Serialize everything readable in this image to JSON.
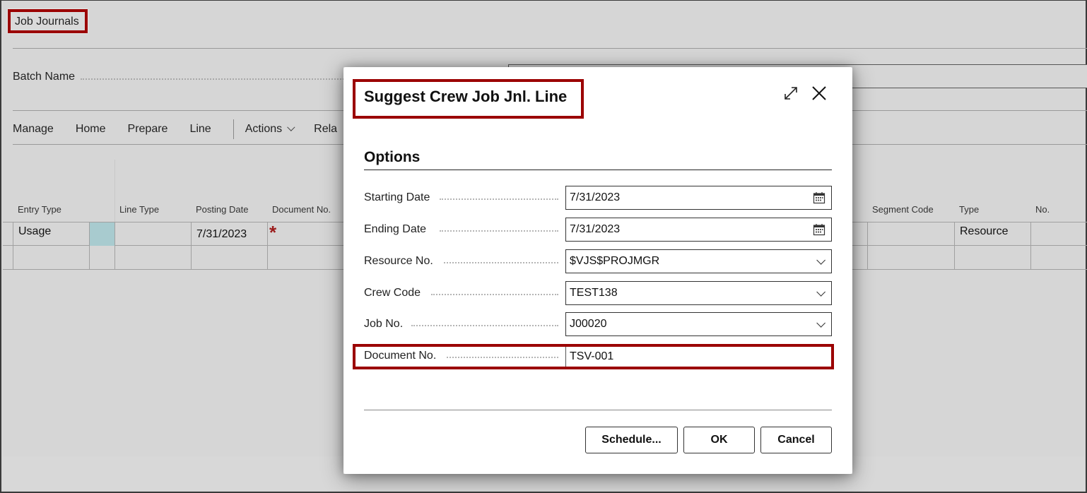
{
  "page": {
    "title": "Job Journals",
    "batch_name_label": "Batch Name",
    "batch_name_value": ""
  },
  "action_bar": {
    "items": [
      "Manage",
      "Home",
      "Prepare",
      "Line"
    ],
    "actions_label": "Actions",
    "related_label_partial": "Rela"
  },
  "grid": {
    "columns_left": [
      "Entry Type",
      "Line Type",
      "Posting Date",
      "Document No."
    ],
    "columns_right": [
      "Segment Code",
      "Type",
      "No."
    ],
    "rows": [
      {
        "entry_type": "Usage",
        "line_type": "",
        "posting_date": "7/31/2023",
        "document_no": "",
        "document_no_required": true,
        "segment_code": "",
        "type": "Resource",
        "no": ""
      },
      {
        "entry_type": "",
        "line_type": "",
        "posting_date": "",
        "document_no": "",
        "segment_code": "",
        "type": "",
        "no": ""
      }
    ],
    "required_marker": "*"
  },
  "dialog": {
    "title": "Suggest Crew Job Jnl. Line",
    "section_title": "Options",
    "fields": [
      {
        "label": "Starting Date",
        "value": "7/31/2023",
        "control": "date",
        "icon": "calendar-icon"
      },
      {
        "label": "Ending Date",
        "value": "7/31/2023",
        "control": "date",
        "icon": "calendar-icon"
      },
      {
        "label": "Resource No.",
        "value": "$VJS$PROJMGR",
        "control": "dropdown",
        "icon": "chevron-down-icon"
      },
      {
        "label": "Crew Code",
        "value": "TEST138",
        "control": "dropdown",
        "icon": "chevron-down-icon"
      },
      {
        "label": "Job No.",
        "value": "J00020",
        "control": "dropdown",
        "icon": "chevron-down-icon"
      },
      {
        "label": "Document No.",
        "value": "TSV-001",
        "control": "text",
        "icon": ""
      }
    ],
    "buttons": {
      "schedule": "Schedule...",
      "ok": "OK",
      "cancel": "Cancel"
    },
    "icons": {
      "expand": "expand-icon",
      "close": "close-icon"
    }
  },
  "colors": {
    "highlight_border": "#9b0000",
    "selected_cell": "#a8cbcf",
    "required_marker": "#9b1b1b",
    "background_dimmed": "#d6d6d6"
  }
}
